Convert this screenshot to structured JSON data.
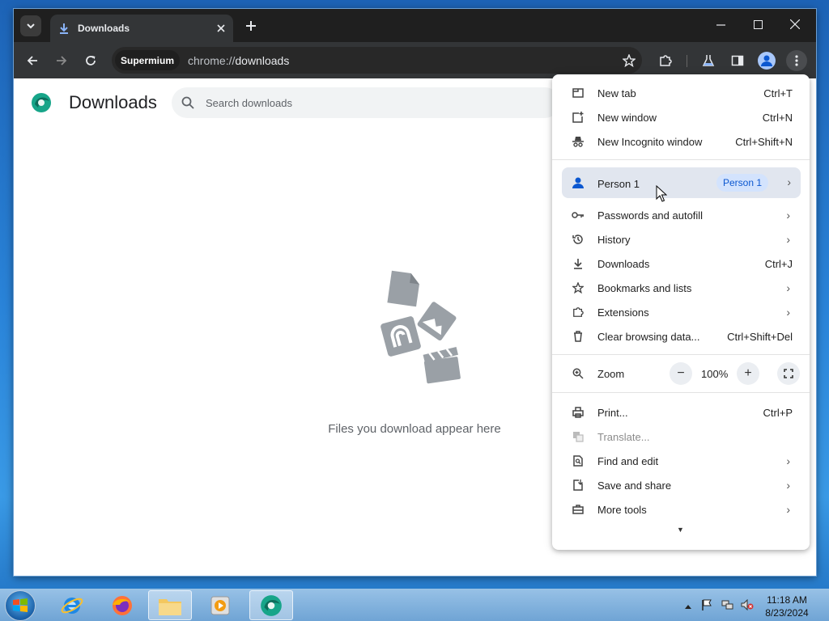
{
  "tab": {
    "title": "Downloads"
  },
  "toolbar": {
    "chip": "Supermium",
    "url_scheme": "chrome://",
    "url_host": "downloads"
  },
  "page": {
    "title": "Downloads",
    "search_placeholder": "Search downloads",
    "empty_text": "Files you download appear here"
  },
  "menu": {
    "new_tab": {
      "label": "New tab",
      "shortcut": "Ctrl+T"
    },
    "new_window": {
      "label": "New window",
      "shortcut": "Ctrl+N"
    },
    "incognito": {
      "label": "New Incognito window",
      "shortcut": "Ctrl+Shift+N"
    },
    "person": {
      "label": "Person 1",
      "chip": "Person 1"
    },
    "passwords": {
      "label": "Passwords and autofill"
    },
    "history": {
      "label": "History"
    },
    "downloads": {
      "label": "Downloads",
      "shortcut": "Ctrl+J"
    },
    "bookmarks": {
      "label": "Bookmarks and lists"
    },
    "extensions": {
      "label": "Extensions"
    },
    "clear": {
      "label": "Clear browsing data...",
      "shortcut": "Ctrl+Shift+Del"
    },
    "zoom": {
      "label": "Zoom",
      "value": "100%",
      "minus": "−",
      "plus": "+"
    },
    "print": {
      "label": "Print...",
      "shortcut": "Ctrl+P"
    },
    "translate": {
      "label": "Translate..."
    },
    "find": {
      "label": "Find and edit"
    },
    "save": {
      "label": "Save and share"
    },
    "more_tools": {
      "label": "More tools"
    }
  },
  "taskbar": {
    "time": "11:18 AM",
    "date": "8/23/2024"
  },
  "colors": {
    "titlebar": "#1f1f1f",
    "toolbar": "#333537",
    "accent": "#0b57d0",
    "person_highlight": "#e1e6ef"
  }
}
